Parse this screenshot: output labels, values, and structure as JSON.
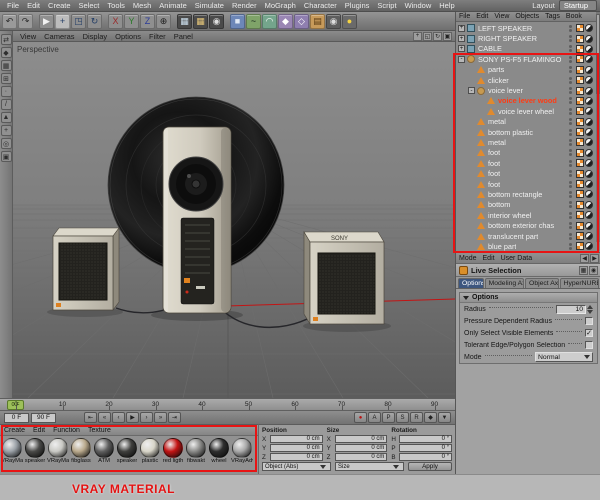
{
  "ui": {
    "check_glyph": "✓"
  },
  "menubar": {
    "items": [
      "File",
      "Edit",
      "Create",
      "Select",
      "Tools",
      "Mesh",
      "Animate",
      "Simulate",
      "Render",
      "MoGraph",
      "Character",
      "Plugins",
      "Script",
      "Window",
      "Help"
    ],
    "layout_label": "Layout",
    "layout_value": "Startup"
  },
  "toolbar": {
    "icons": [
      {
        "name": "undo-icon",
        "glyph": "↶",
        "bg": "#9a9a9a",
        "fg": "#2c2c2c"
      },
      {
        "name": "redo-icon",
        "glyph": "↷",
        "bg": "#9a9a9a",
        "fg": "#2c2c2c"
      },
      {
        "sep": true
      },
      {
        "name": "live-selection-icon",
        "glyph": "▶",
        "bg": "#8f8f8f",
        "fg": "#f2f2f2"
      },
      {
        "name": "move-tool-icon",
        "glyph": "+",
        "bg": "#bcbcbc",
        "fg": "#223d66"
      },
      {
        "name": "scale-tool-icon",
        "glyph": "◳",
        "bg": "#8f8f8f",
        "fg": "#223d66"
      },
      {
        "name": "rotate-tool-icon",
        "glyph": "↻",
        "bg": "#8f8f8f",
        "fg": "#223d66"
      },
      {
        "sep": true
      },
      {
        "name": "x-axis-lock-icon",
        "glyph": "X",
        "bg": "#8f8f8f",
        "fg": "#9a2a2a"
      },
      {
        "name": "y-axis-lock-icon",
        "glyph": "Y",
        "bg": "#8f8f8f",
        "fg": "#2a7a2a"
      },
      {
        "name": "z-axis-lock-icon",
        "glyph": "Z",
        "bg": "#8f8f8f",
        "fg": "#2a3a9a"
      },
      {
        "name": "coordinate-system-icon",
        "glyph": "⊕",
        "bg": "#8f8f8f",
        "fg": "#222222"
      },
      {
        "sep": true
      },
      {
        "name": "render-view-icon",
        "glyph": "▦",
        "bg": "#4a4a4a",
        "fg": "#cfe2f0"
      },
      {
        "name": "render-picture-viewer-icon",
        "glyph": "▦",
        "bg": "#4a4a4a",
        "fg": "#e8c87a"
      },
      {
        "name": "render-settings-icon",
        "glyph": "◉",
        "bg": "#4a4a4a",
        "fg": "#dddddd"
      },
      {
        "sep": true
      },
      {
        "name": "add-primitive-icon",
        "glyph": "■",
        "bg": "#6d87b8",
        "fg": "#dfe8f5"
      },
      {
        "name": "add-spline-icon",
        "glyph": "~",
        "bg": "#7fa369",
        "fg": "#15241a"
      },
      {
        "name": "add-nurbs-icon",
        "glyph": "◠",
        "bg": "#74a58c",
        "fg": "#ffffff"
      },
      {
        "name": "add-modeling-icon",
        "glyph": "◆",
        "bg": "#9a86b4",
        "fg": "#ffffff"
      },
      {
        "name": "add-deformer-icon",
        "glyph": "◇",
        "bg": "#8f7fb0",
        "fg": "#ffffff"
      },
      {
        "name": "add-environment-icon",
        "glyph": "▤",
        "bg": "#c79a5a",
        "fg": "#5a3a12"
      },
      {
        "name": "add-camera-icon",
        "glyph": "◉",
        "bg": "#5d5d5d",
        "fg": "#dddddd"
      },
      {
        "name": "add-light-icon",
        "glyph": "●",
        "bg": "#6a6a6a",
        "fg": "#f5d442"
      }
    ]
  },
  "left_toolbar": {
    "icons": [
      {
        "name": "make-editable-icon",
        "glyph": "⇄"
      },
      {
        "name": "model-mode-icon",
        "glyph": "◆"
      },
      {
        "name": "texture-mode-icon",
        "glyph": "▦"
      },
      {
        "name": "workplane-icon",
        "glyph": "⊞"
      },
      {
        "name": "points-mode-icon",
        "glyph": "∙"
      },
      {
        "name": "edges-mode-icon",
        "glyph": "/"
      },
      {
        "name": "polygons-mode-icon",
        "glyph": "▲"
      },
      {
        "name": "enable-axis-icon",
        "glyph": "+"
      },
      {
        "name": "snap-icon",
        "glyph": "◎"
      },
      {
        "name": "lock-workplane-icon",
        "glyph": "▣"
      }
    ]
  },
  "viewport": {
    "menu": [
      "View",
      "Cameras",
      "Display",
      "Options",
      "Filter",
      "Panel"
    ],
    "label": "Perspective",
    "nav_icons": [
      {
        "name": "viewport-pan-icon",
        "glyph": "+"
      },
      {
        "name": "viewport-zoom-icon",
        "glyph": "◱"
      },
      {
        "name": "viewport-rotate-icon",
        "glyph": "↻"
      },
      {
        "name": "viewport-toggle-icon",
        "glyph": "▣"
      }
    ],
    "scene": {
      "brand": "SONY"
    }
  },
  "object_manager": {
    "menu": [
      "File",
      "Edit",
      "View",
      "Objects",
      "Tags",
      "Book"
    ],
    "objects": [
      {
        "name": "LEFT SPEAKER",
        "depth": 0,
        "expander": "+",
        "icon": "cube",
        "tags": [
          "texture",
          "phong"
        ]
      },
      {
        "name": "RIGHT SPEAKER",
        "depth": 0,
        "expander": "+",
        "icon": "cube",
        "tags": [
          "texture",
          "phong"
        ]
      },
      {
        "name": "CABLE",
        "depth": 0,
        "expander": "+",
        "icon": "cube",
        "tags": [
          "texture",
          "phong"
        ]
      },
      {
        "name": "SONY PS-F5 FLAMINGO",
        "depth": 0,
        "expander": "-",
        "icon": "null",
        "tags": [
          "texture",
          "phong"
        ]
      },
      {
        "name": "parts",
        "depth": 1,
        "icon": "poly",
        "tags": [
          "texture",
          "phong"
        ]
      },
      {
        "name": "clicker",
        "depth": 1,
        "icon": "poly",
        "tags": [
          "texture",
          "phong"
        ]
      },
      {
        "name": "voice lever",
        "depth": 1,
        "expander": "-",
        "icon": "null",
        "tags": [
          "texture",
          "phong"
        ]
      },
      {
        "name": "voice lever wood",
        "depth": 2,
        "icon": "poly",
        "selected": true,
        "tags": [
          "texture",
          "phong"
        ]
      },
      {
        "name": "voice lever wheel",
        "depth": 2,
        "icon": "poly",
        "tags": [
          "texture",
          "phong"
        ]
      },
      {
        "name": "metal",
        "depth": 1,
        "icon": "poly",
        "tags": [
          "texture",
          "phong"
        ]
      },
      {
        "name": "bottom plastic",
        "depth": 1,
        "icon": "poly",
        "tags": [
          "texture",
          "phong"
        ]
      },
      {
        "name": "metal",
        "depth": 1,
        "icon": "poly",
        "tags": [
          "texture",
          "phong"
        ]
      },
      {
        "name": "foot",
        "depth": 1,
        "icon": "poly",
        "tags": [
          "texture",
          "phong"
        ]
      },
      {
        "name": "foot",
        "depth": 1,
        "icon": "poly",
        "tags": [
          "texture",
          "phong"
        ]
      },
      {
        "name": "foot",
        "depth": 1,
        "icon": "poly",
        "tags": [
          "texture",
          "phong"
        ]
      },
      {
        "name": "foot",
        "depth": 1,
        "icon": "poly",
        "tags": [
          "texture",
          "phong"
        ]
      },
      {
        "name": "bottom rectangle",
        "depth": 1,
        "icon": "poly",
        "tags": [
          "texture",
          "phong"
        ]
      },
      {
        "name": "bottom",
        "depth": 1,
        "icon": "poly",
        "tags": [
          "texture",
          "phong"
        ]
      },
      {
        "name": "interior wheel",
        "depth": 1,
        "icon": "poly",
        "tags": [
          "texture",
          "phong"
        ]
      },
      {
        "name": "bottom exterior chas",
        "depth": 1,
        "icon": "poly",
        "tags": [
          "texture",
          "phong"
        ]
      },
      {
        "name": "translucent part",
        "depth": 1,
        "icon": "poly",
        "tags": [
          "texture",
          "phong"
        ]
      },
      {
        "name": "blue part",
        "depth": 1,
        "icon": "poly",
        "tags": [
          "texture",
          "phong"
        ]
      }
    ]
  },
  "attribute_manager": {
    "menu": [
      "Mode",
      "Edit",
      "User Data"
    ],
    "nav_icons": [
      {
        "name": "am-back-icon",
        "glyph": "◀"
      },
      {
        "name": "am-forward-icon",
        "glyph": "▶"
      }
    ],
    "title_icons": [
      {
        "name": "panel-grid-icon",
        "glyph": "▦"
      },
      {
        "name": "lock-icon",
        "glyph": "◉"
      }
    ],
    "tool": {
      "name": "Live Selection"
    },
    "tabs": [
      {
        "label": "Options",
        "active": true
      },
      {
        "label": "Modeling Axis"
      },
      {
        "label": "Object Axis"
      },
      {
        "label": "HyperNURBS"
      }
    ],
    "group_title": "Options",
    "rows": [
      {
        "label": "Radius",
        "type": "number",
        "value": "10"
      },
      {
        "label": "Pressure Dependent Radius",
        "type": "checkbox",
        "checked": false
      },
      {
        "label": "Only Select Visible Elements",
        "type": "checkbox",
        "checked": true
      },
      {
        "label": "Tolerant Edge/Polygon Selection",
        "type": "checkbox",
        "checked": false
      },
      {
        "label": "Mode",
        "type": "select",
        "value": "Normal"
      }
    ]
  },
  "timeline": {
    "ticks": [
      "0",
      "10",
      "20",
      "30",
      "40",
      "50",
      "60",
      "70",
      "80",
      "90"
    ],
    "playhead": "0 F",
    "start_field": "0 F",
    "end_field": "90 F",
    "transport": [
      {
        "name": "goto-start-button",
        "glyph": "⇤"
      },
      {
        "name": "prev-key-button",
        "glyph": "«"
      },
      {
        "name": "prev-frame-button",
        "glyph": "‹"
      },
      {
        "name": "play-button",
        "glyph": "▶"
      },
      {
        "name": "next-frame-button",
        "glyph": "›"
      },
      {
        "name": "next-key-button",
        "glyph": "»"
      },
      {
        "name": "goto-end-button",
        "glyph": "⇥"
      }
    ],
    "toggles": [
      {
        "name": "record-keyframe-button",
        "glyph": "●",
        "color": "#bb1111"
      },
      {
        "name": "autokey-button",
        "glyph": "A",
        "color": "#222222"
      },
      {
        "name": "record-position-toggle",
        "glyph": "P",
        "color": "#222222"
      },
      {
        "name": "record-scale-toggle",
        "glyph": "S",
        "color": "#222222"
      },
      {
        "name": "record-rotation-toggle",
        "glyph": "R",
        "color": "#222222"
      },
      {
        "name": "record-parameter-toggle",
        "glyph": "◆",
        "color": "#222222"
      },
      {
        "name": "playback-settings-button",
        "glyph": "▼",
        "color": "#222222"
      }
    ]
  },
  "material_manager": {
    "menu": [
      "Create",
      "Edit",
      "Function",
      "Texture"
    ],
    "materials": [
      {
        "name": "VRayMat",
        "color": "#9aa0a6"
      },
      {
        "name": "speaker",
        "color": "#4a4a48"
      },
      {
        "name": "VRayMat",
        "color": "#c9c9c4"
      },
      {
        "name": "fibglass",
        "color": "#b9a98c"
      },
      {
        "name": "ATM",
        "color": "#5f5f5f"
      },
      {
        "name": "speaker",
        "color": "#3f3f3d"
      },
      {
        "name": "plastic",
        "color": "#d8d5c8"
      },
      {
        "name": "red ligth",
        "color": "#c41414"
      },
      {
        "name": "fibwakt",
        "color": "#8a8a88"
      },
      {
        "name": "wheel",
        "color": "#2e2e2e"
      },
      {
        "name": "VRayAdv",
        "color": "#a8a8a8"
      }
    ]
  },
  "coordinates": {
    "columns": [
      {
        "header": "Position",
        "rows": [
          {
            "axis": "X",
            "value": "0 cm"
          },
          {
            "axis": "Y",
            "value": "0 cm"
          },
          {
            "axis": "Z",
            "value": "0 cm"
          }
        ]
      },
      {
        "header": "Size",
        "rows": [
          {
            "axis": "X",
            "value": "0 cm"
          },
          {
            "axis": "Y",
            "value": "0 cm"
          },
          {
            "axis": "Z",
            "value": "0 cm"
          }
        ]
      },
      {
        "header": "Rotation",
        "rows": [
          {
            "axis": "H",
            "value": "0 °"
          },
          {
            "axis": "P",
            "value": "0 °"
          },
          {
            "axis": "B",
            "value": "0 °"
          }
        ]
      }
    ],
    "mode_select": "Object (Abs)",
    "size_select": "Size",
    "apply_label": "Apply"
  },
  "annotations": {
    "label": "VRAY MATERIAL",
    "color": "#e41212"
  }
}
